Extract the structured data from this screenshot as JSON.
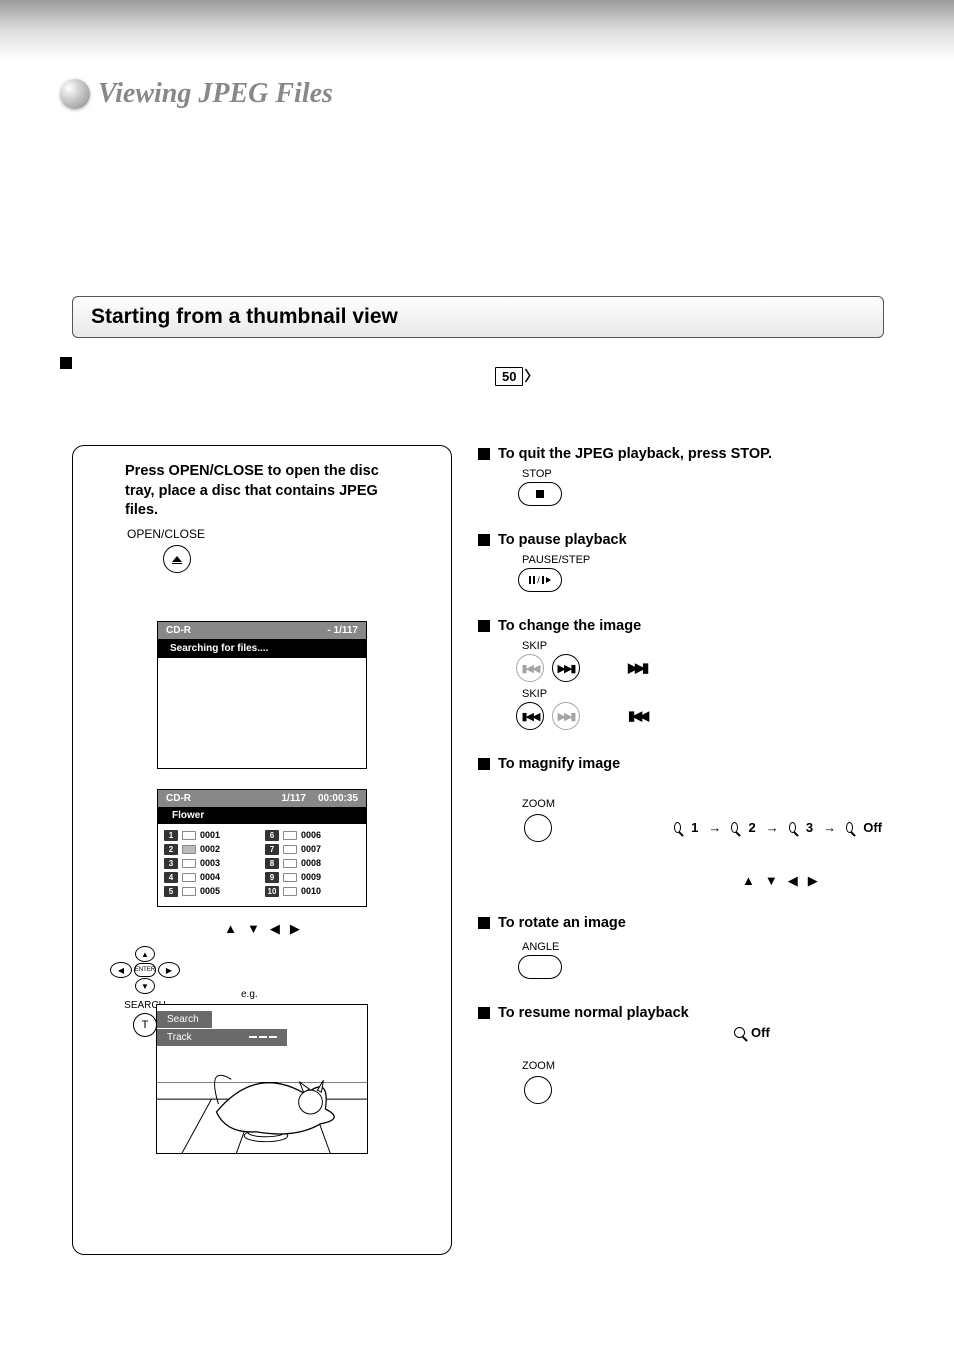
{
  "page_title": "Viewing JPEG Files",
  "section_title": "Starting from a thumbnail view",
  "page_ref": "50",
  "left": {
    "step1_text": "Press OPEN/CLOSE to open the disc tray, place a disc that contains JPEG files.",
    "open_close_label": "OPEN/CLOSE",
    "screen1_disc": "CD-R",
    "screen1_counter": "- 1/117",
    "screen1_status": "Searching for files....",
    "screen2_disc": "CD-R",
    "screen2_counter": "1/117",
    "screen2_time": "00:00:35",
    "screen2_folder": "Flower",
    "files_col1": [
      {
        "n": "1",
        "name": "0001"
      },
      {
        "n": "2",
        "name": "0002",
        "selected": true
      },
      {
        "n": "3",
        "name": "0003"
      },
      {
        "n": "4",
        "name": "0004"
      },
      {
        "n": "5",
        "name": "0005"
      }
    ],
    "files_col2": [
      {
        "n": "6",
        "name": "0006"
      },
      {
        "n": "7",
        "name": "0007"
      },
      {
        "n": "8",
        "name": "0008"
      },
      {
        "n": "9",
        "name": "0009"
      },
      {
        "n": "10",
        "name": "0010"
      }
    ],
    "dpad_enter": "ENTER",
    "search_label": "SEARCH",
    "t_label": "T",
    "eg_label": "e.g.",
    "overlay_search": "Search",
    "overlay_track": "Track"
  },
  "right": {
    "quit_heading": "To quit the JPEG playback, press STOP.",
    "stop_label": "STOP",
    "pause_heading": "To pause playback",
    "pause_label": "PAUSE/STEP",
    "change_heading": "To change the image",
    "skip_label": "SKIP",
    "magnify_heading": "To magnify image",
    "zoom_label": "ZOOM",
    "zoom1": "1",
    "zoom2": "2",
    "zoom3": "3",
    "zoom_off": "Off",
    "rotate_heading": "To rotate an image",
    "angle_label": "ANGLE",
    "resume_heading": "To resume normal playback",
    "resume_off": "Off"
  }
}
